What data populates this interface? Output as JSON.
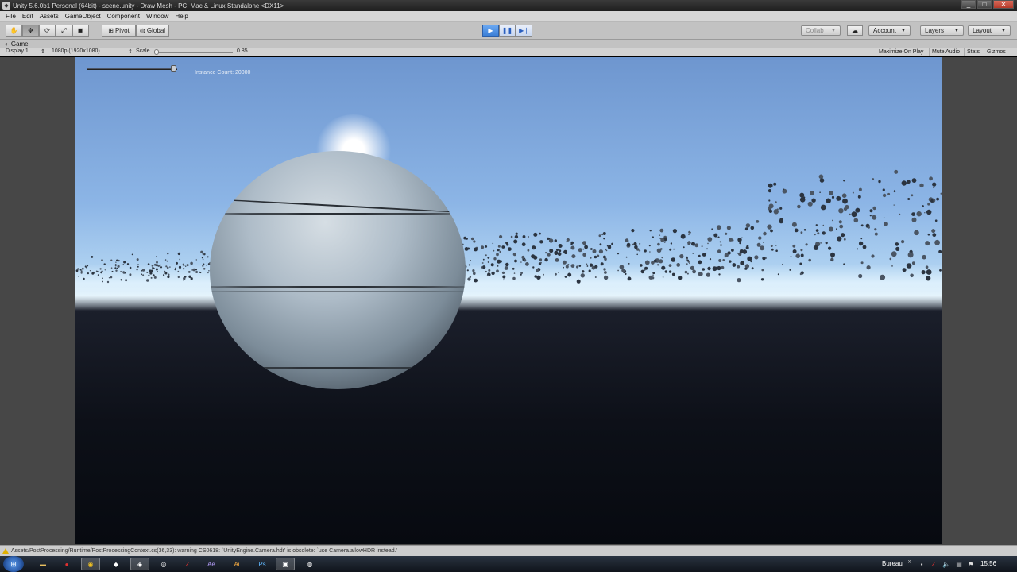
{
  "window": {
    "title": "Unity 5.6.0b1 Personal (64bit) - scene.unity - Draw Mesh - PC, Mac & Linux Standalone <DX11>",
    "minimize": "_",
    "maximize": "□",
    "close": "✕"
  },
  "menu": [
    "File",
    "Edit",
    "Assets",
    "GameObject",
    "Component",
    "Window",
    "Help"
  ],
  "toolbar": {
    "pivot_label": "Pivot",
    "global_label": "Global",
    "collab_label": "Collab",
    "account_label": "Account",
    "layers_label": "Layers",
    "layout_label": "Layout"
  },
  "game_tab": {
    "label": "Game",
    "display": "Display 1",
    "resolution": "1080p (1920x1080)",
    "scale_label": "Scale",
    "scale_value": "0.85",
    "maximize_on_play": "Maximize On Play",
    "mute_audio": "Mute Audio",
    "stats": "Stats",
    "gizmos": "Gizmos"
  },
  "game_view": {
    "instance_label": "Instance Count: 20000",
    "slider_fraction": 1.0
  },
  "status": {
    "message": "Assets/PostProcessing/Runtime/PostProcessingContext.cs(36,33): warning CS0618: `UnityEngine.Camera.hdr' is obsolete: `use Camera.allowHDR instead.'"
  },
  "taskbar": {
    "tray_label": "Bureau",
    "clock": "15:56"
  },
  "colors": {
    "play_active": "#3c7fd6",
    "sky_top": "#6e96cf",
    "ground": "#0d1018"
  }
}
